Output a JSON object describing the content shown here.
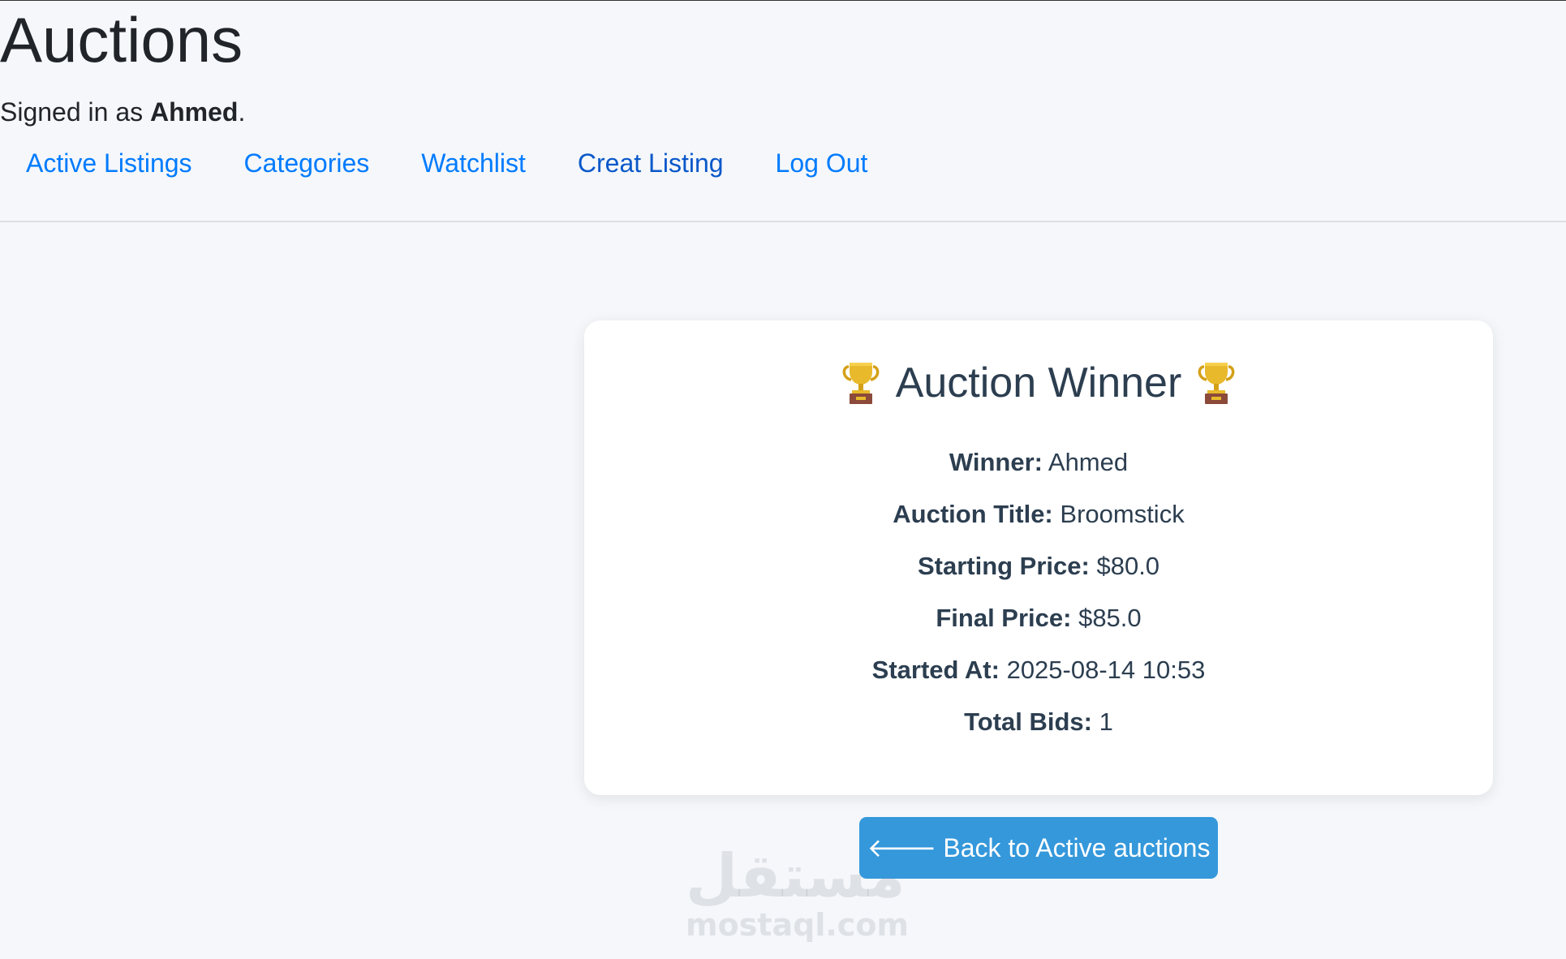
{
  "header": {
    "title": "Auctions",
    "signed_in_prefix": "Signed in as ",
    "username": "Ahmed",
    "signed_in_suffix": "."
  },
  "nav": {
    "items": [
      {
        "label": "Active Listings"
      },
      {
        "label": "Categories"
      },
      {
        "label": "Watchlist"
      },
      {
        "label": "Creat Listing"
      },
      {
        "label": "Log Out"
      }
    ]
  },
  "card": {
    "heading": "Auction Winner",
    "icon": "trophy-icon",
    "rows": [
      {
        "label": "Winner:",
        "value": "Ahmed"
      },
      {
        "label": "Auction Title:",
        "value": "Broomstick"
      },
      {
        "label": "Starting Price:",
        "value": "$80.0"
      },
      {
        "label": "Final Price:",
        "value": "$85.0"
      },
      {
        "label": "Started At:",
        "value": "2025-08-14 10:53"
      },
      {
        "label": "Total Bids:",
        "value": "1"
      }
    ]
  },
  "back_button": {
    "arrow": "🡐",
    "label": "Back to Active auctions"
  },
  "watermark": {
    "arabic": "مستقل",
    "latin": "mostaql.com"
  },
  "colors": {
    "link": "#007bff",
    "button": "#3498db",
    "heading": "#2c3e50",
    "background": "#f5f7fa"
  }
}
